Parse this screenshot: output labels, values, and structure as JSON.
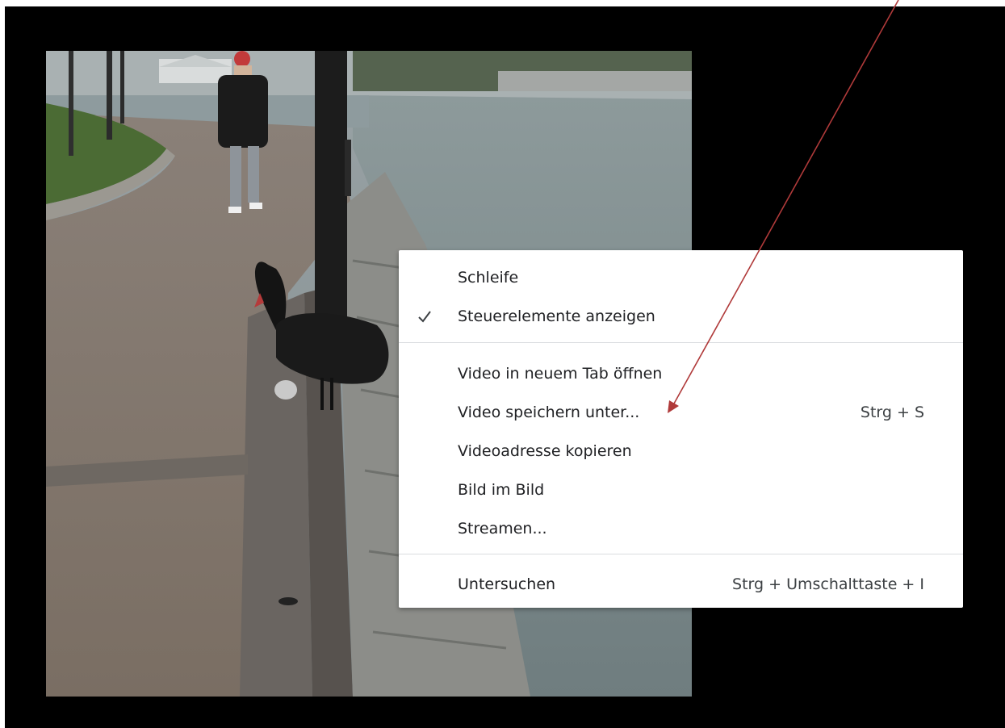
{
  "context_menu": {
    "items": [
      {
        "label": "Schleife",
        "shortcut": ""
      },
      {
        "label": "Steuerelemente anzeigen",
        "shortcut": "",
        "checked": true
      },
      {
        "label": "Video in neuem Tab öffnen",
        "shortcut": ""
      },
      {
        "label": "Video speichern unter...",
        "shortcut": "Strg + S"
      },
      {
        "label": "Videoadresse kopieren",
        "shortcut": ""
      },
      {
        "label": "Bild im Bild",
        "shortcut": ""
      },
      {
        "label": "Streamen...",
        "shortcut": ""
      },
      {
        "label": "Untersuchen",
        "shortcut": "Strg + Umschalttaste + I"
      }
    ]
  },
  "icons": {
    "check": "check-icon",
    "annotation": "arrow-annotation-icon"
  },
  "colors": {
    "background": "#000000",
    "menu_background": "#ffffff",
    "menu_text": "#202124",
    "separator": "#dadce0",
    "annotation_arrow": "#b03a3a"
  }
}
